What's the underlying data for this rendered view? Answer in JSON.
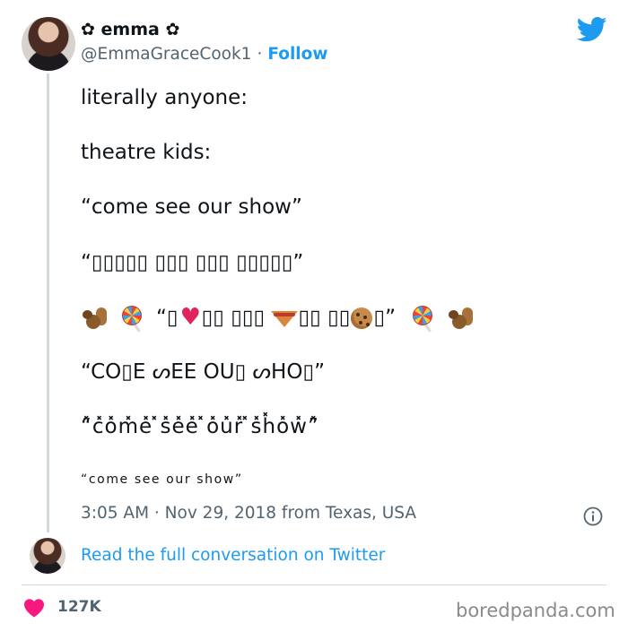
{
  "author": {
    "display_name": "✿ emma ✿",
    "handle": "@EmmaGraceCook1",
    "separator": "·",
    "follow_label": "Follow"
  },
  "tweet": {
    "lines": [
      "literally anyone:",
      "theatre kids:",
      "“come see our show”",
      "“▯▯▯▯▯ ▯▯▯ ▯▯▯ ▯▯▯▯▯”",
      "“CO▯E ᔕEE OU▯ ᔕHO▯”",
      "“̽c̽o̽m̽e̽ ̽s̽e̽e̽ ̽o̽u̽r̽ ̽s̽h̽o̽w̽”̽",
      "“come see our show”"
    ],
    "emoji_line": {
      "open_quote": "“▯",
      "mid1": "▯▯ ▯▯▯ ",
      "mid2": "▯▯ ▯▯",
      "close": "▯”"
    },
    "icons": [
      "squirrel-icon",
      "lollipop-icon",
      "heart-icon",
      "pie-icon",
      "cookie-icon"
    ]
  },
  "footer": {
    "timestamp": "3:05 AM · Nov 29, 2018 from Texas, USA",
    "read_link": "Read the full conversation on Twitter",
    "likes": "127K"
  },
  "watermark": "boredpanda.com",
  "colors": {
    "accent": "#1d9bf0",
    "like": "#f91880",
    "text": "#0f1419",
    "secondary": "#536471"
  }
}
